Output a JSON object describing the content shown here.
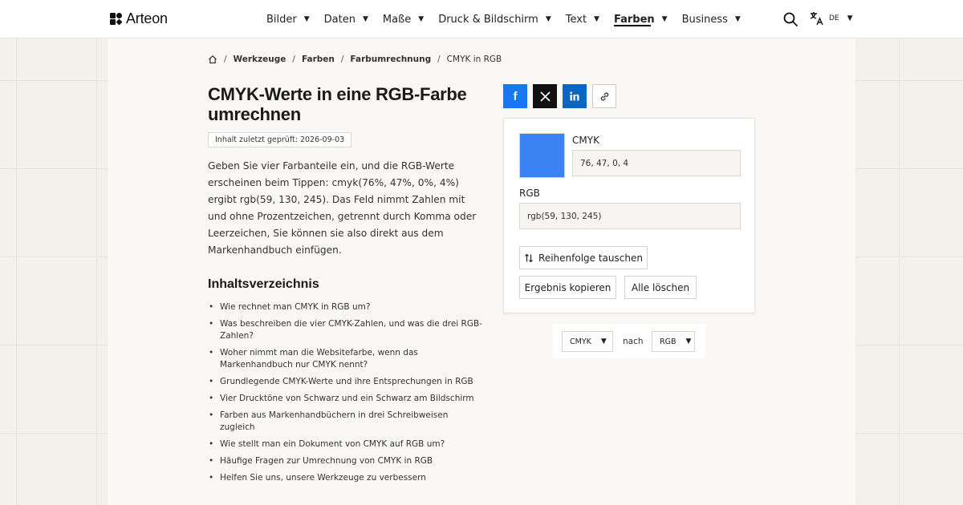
{
  "brand": {
    "name": "Arteon"
  },
  "nav": {
    "items": [
      {
        "label": "Bilder",
        "active": false
      },
      {
        "label": "Daten",
        "active": false
      },
      {
        "label": "Maße",
        "active": false
      },
      {
        "label": "Druck & Bildschirm",
        "active": false
      },
      {
        "label": "Text",
        "active": false
      },
      {
        "label": "Farben",
        "active": true
      },
      {
        "label": "Business",
        "active": false
      }
    ],
    "language": "DE"
  },
  "breadcrumb": {
    "items": [
      "Werkzeuge",
      "Farbumrechnung"
    ],
    "category": "Farben",
    "current": "CMYK in RGB"
  },
  "page": {
    "title": "CMYK-Werte in eine RGB-Farbe umrechnen",
    "last_checked": "Inhalt zuletzt geprüft: 2026-09-03",
    "intro": "Geben Sie vier Farbanteile ein, und die RGB-Werte erscheinen beim Tippen: cmyk(76%, 47%, 0%, 4%) ergibt rgb(59, 130, 245). Das Feld nimmt Zahlen mit und ohne Prozentzeichen, getrennt durch Komma oder Leerzeichen, Sie können sie also direkt aus dem Markenhandbuch einfügen."
  },
  "toc": {
    "heading": "Inhaltsverzeichnis",
    "items": [
      "Wie rechnet man CMYK in RGB um?",
      "Was beschreiben die vier CMYK-Zahlen, und was die drei RGB-Zahlen?",
      "Woher nimmt man die Websitefarbe, wenn das Markenhandbuch nur CMYK nennt?",
      "Grundlegende CMYK-Werte und ihre Entsprechungen in RGB",
      "Vier Drucktöne von Schwarz und ein Schwarz am Bildschirm",
      "Farben aus Markenhandbüchern in drei Schreibweisen zugleich",
      "Wie stellt man ein Dokument von CMYK auf RGB um?",
      "Häufige Fragen zur Umrechnung von CMYK in RGB",
      "Helfen Sie uns, unsere Werkzeuge zu verbessern"
    ]
  },
  "converter": {
    "swatch_color": "#3b82f5",
    "cmyk_label": "CMYK",
    "cmyk_value": "76, 47, 0, 4",
    "rgb_label": "RGB",
    "rgb_value": "rgb(59, 130, 245)",
    "swap_label": "Reihenfolge tauschen",
    "copy_label": "Ergebnis kopieren",
    "clear_label": "Alle löschen"
  },
  "conversion": {
    "from": "CMYK",
    "connector": "nach",
    "to": "RGB"
  },
  "colors": {
    "facebook": "#1877f2",
    "x": "#111111",
    "linkedin": "#0a66c2"
  }
}
